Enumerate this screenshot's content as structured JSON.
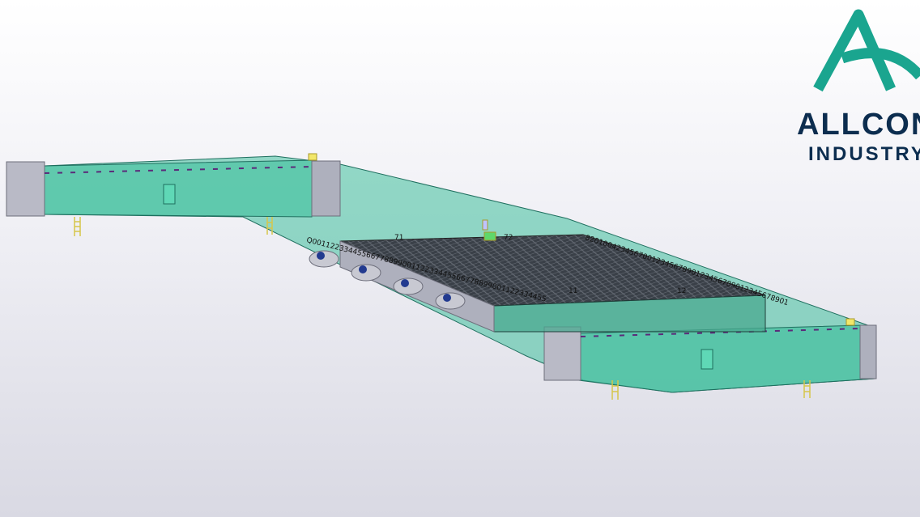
{
  "logo": {
    "name": "ALLCON",
    "sub": "INDUSTRY",
    "mark_color": "#1aa58f",
    "text_color": "#0c2d4f"
  },
  "labels": {
    "l71": "71",
    "l72": "72",
    "l11": "11",
    "l12": "12",
    "dense_right": "8201004234567001234567890123456789012345678901",
    "dense_left": "Q0011223344556677889900112233445566778899001122334455"
  },
  "colors": {
    "hull": "#3fbf9d",
    "hull_edge": "#1f6f5f",
    "deck": "#2b3138",
    "steel": "#b9bac6",
    "ladder": "#f2e76a"
  }
}
